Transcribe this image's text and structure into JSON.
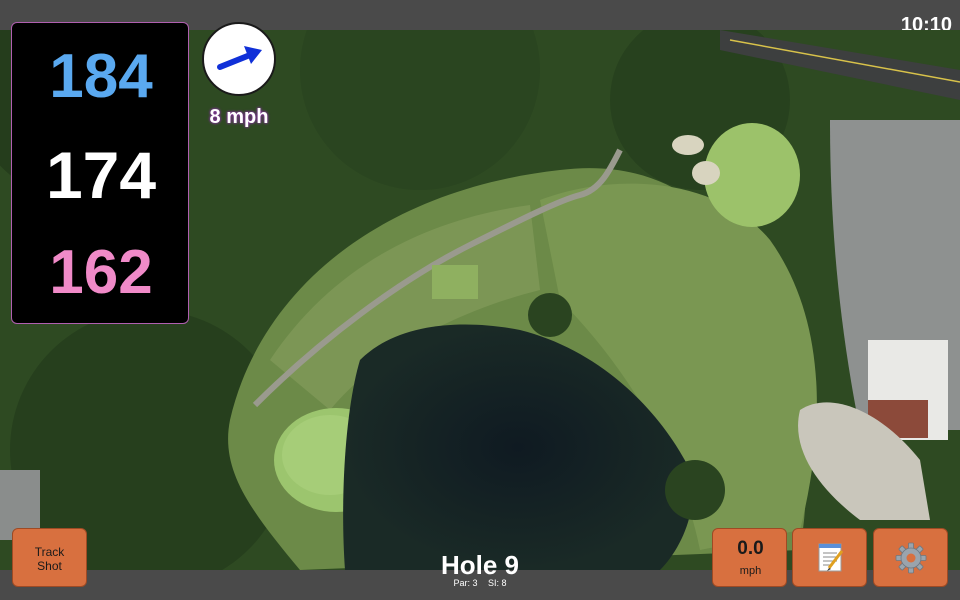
{
  "status_bar": {
    "time": "10:10"
  },
  "distances": {
    "back": {
      "value": "184",
      "color": "#5aa9f0"
    },
    "middle": {
      "value": "174",
      "color": "#ffffff"
    },
    "front": {
      "value": "162",
      "color": "#f08ac8"
    }
  },
  "wind": {
    "speed": "8 mph",
    "arrow_color": "#1030d8",
    "icon": "wind-arrow-icon"
  },
  "hole": {
    "title": "Hole 9",
    "par": "Par: 3",
    "stroke_index": "SI: 8"
  },
  "buttons": {
    "track_shot": [
      "Track",
      "Shot"
    ],
    "speed_value": "0.0",
    "speed_unit": "mph",
    "notes_icon": "notepad-icon",
    "settings_icon": "gear-icon"
  },
  "colors": {
    "button": "#d8703f",
    "panel_border": "#b05fb0"
  }
}
